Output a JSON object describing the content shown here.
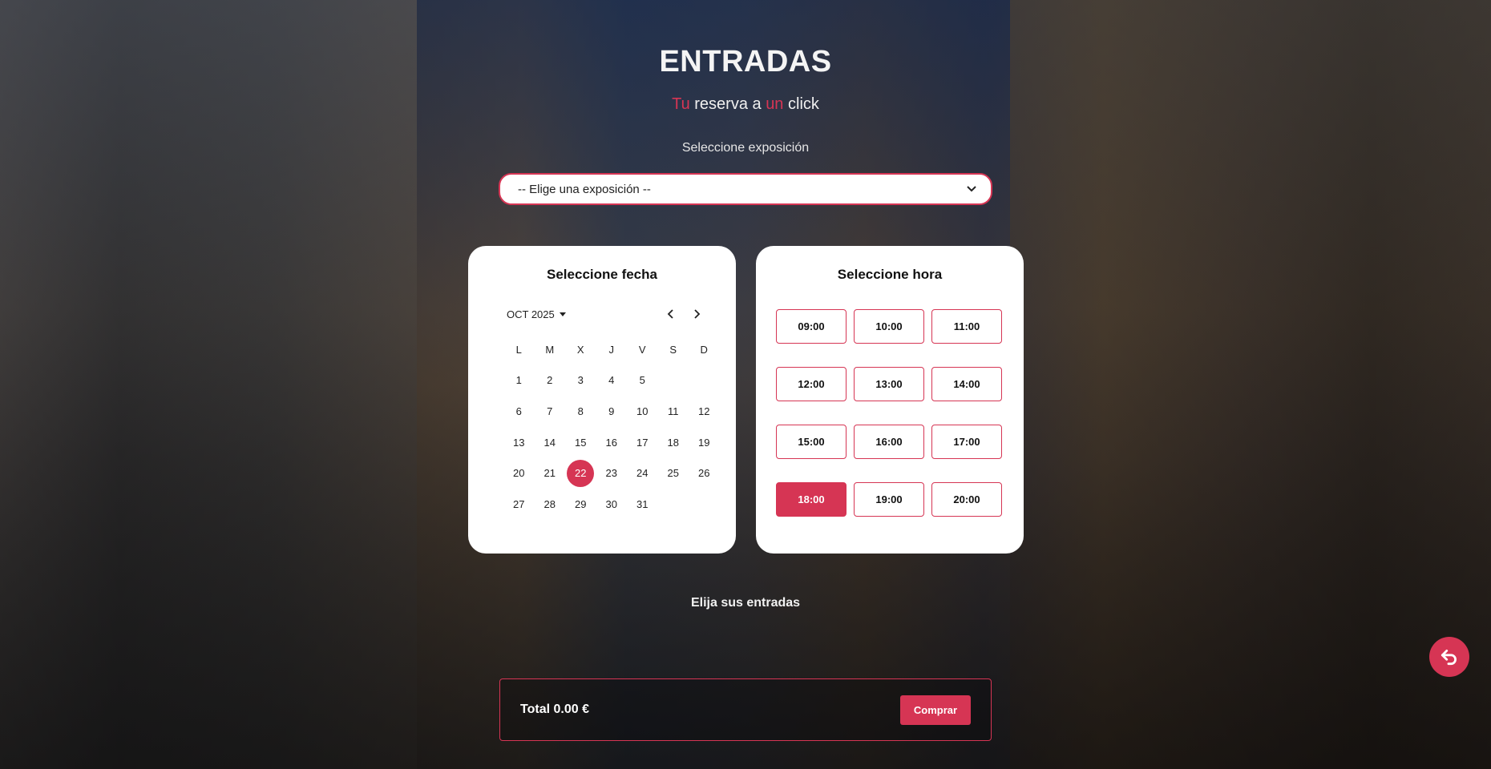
{
  "header": {
    "title": "ENTRADAS",
    "subtitle_parts": [
      "Tu",
      " reserva a ",
      "un",
      " click"
    ]
  },
  "exhibition": {
    "label": "Seleccione exposición",
    "selected": "-- Elige una exposición --"
  },
  "date_card": {
    "title": "Seleccione fecha",
    "month": "OCT 2025",
    "weekdays": [
      "L",
      "M",
      "X",
      "J",
      "V",
      "S",
      "D"
    ],
    "days": [
      "1",
      "2",
      "3",
      "4",
      "5",
      "",
      "",
      "6",
      "7",
      "8",
      "9",
      "10",
      "11",
      "12",
      "13",
      "14",
      "15",
      "16",
      "17",
      "18",
      "19",
      "20",
      "21",
      "22",
      "23",
      "24",
      "25",
      "26",
      "27",
      "28",
      "29",
      "30",
      "31",
      "",
      ""
    ],
    "selected_day": "22"
  },
  "time_card": {
    "title": "Seleccione hora",
    "slots": [
      "09:00",
      "10:00",
      "11:00",
      "12:00",
      "13:00",
      "14:00",
      "15:00",
      "16:00",
      "17:00",
      "18:00",
      "19:00",
      "20:00"
    ],
    "selected_slot": "18:00"
  },
  "tickets": {
    "label": "Elija sus entradas"
  },
  "summary": {
    "total": "Total 0.00 €",
    "buy_label": "Comprar"
  },
  "icons": {
    "prev": "chevron-left-icon",
    "next": "chevron-right-icon",
    "caret": "caret-down-icon",
    "back": "undo-arrow-icon"
  },
  "colors": {
    "accent": "#d63554",
    "card": "#ffffff"
  }
}
